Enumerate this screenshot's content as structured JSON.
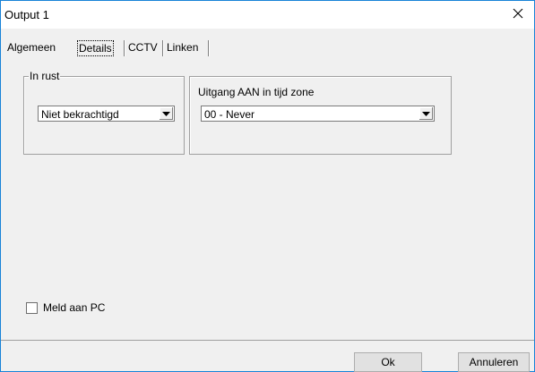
{
  "window": {
    "title": "Output 1",
    "close_icon": "close-icon"
  },
  "tabs": [
    {
      "label": "Algemeen",
      "active": false
    },
    {
      "label": "Details",
      "active": true
    },
    {
      "label": "CCTV",
      "active": false
    },
    {
      "label": "Linken",
      "active": false
    }
  ],
  "in_rust": {
    "legend": "In rust",
    "selected": "Niet bekrachtigd"
  },
  "time_zone": {
    "label": "Uitgang AAN in tijd zone",
    "selected": "00 - Never"
  },
  "meld_aan_pc": {
    "label": "Meld aan PC",
    "checked": false
  },
  "buttons": {
    "ok": "Ok",
    "cancel": "Annuleren"
  },
  "colors": {
    "window_border": "#1883d7",
    "dialog_bg": "#f0f0f0",
    "button_bg": "#e1e1e1"
  }
}
